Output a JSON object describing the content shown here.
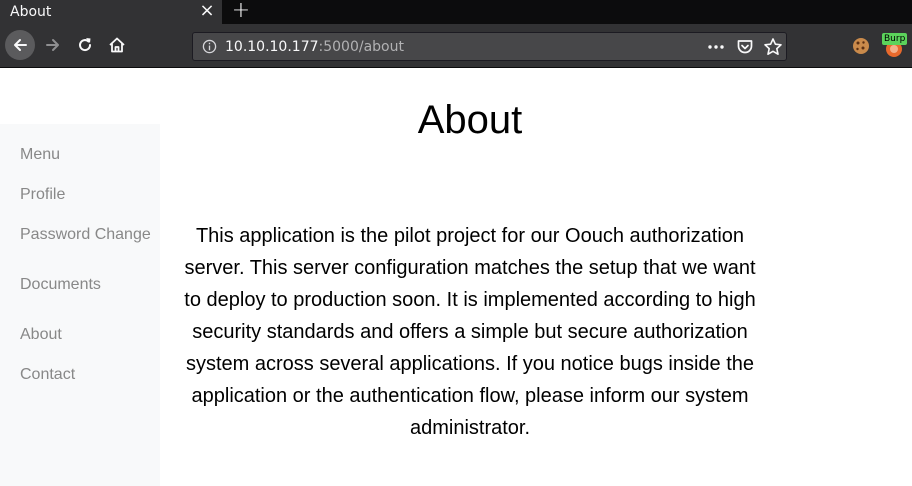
{
  "browser": {
    "tab_title": "About",
    "tab_close": "×",
    "new_tab": "+",
    "url_host": "10.10.10.177",
    "url_rest": ":5000/about",
    "burp_label": "Burp"
  },
  "page": {
    "title": "About",
    "sidebar": {
      "items": [
        {
          "label": "Menu"
        },
        {
          "label": "Profile"
        },
        {
          "label": "Password Change"
        },
        {
          "label": "Documents"
        },
        {
          "label": "About"
        },
        {
          "label": "Contact"
        }
      ]
    },
    "body_text": "This application is the pilot project for our Oouch authorization server. This server configuration matches the setup that we want to deploy to production soon. It is implemented according to high security standards and offers a simple but secure authorization system across several applications. If you notice bugs inside the application or the authentication flow, please inform our system administrator."
  },
  "colors": {
    "chrome_dark": "#0c0c0d",
    "chrome": "#323234",
    "urlbar": "#474749",
    "sidebar_bg": "#f8f9fa",
    "sidebar_link": "#888888",
    "burp_badge": "#5bd35b"
  },
  "icons": [
    "back-arrow-icon",
    "forward-arrow-icon",
    "reload-icon",
    "home-icon",
    "info-icon",
    "more-dots-icon",
    "pocket-icon",
    "star-icon",
    "cookie-extension-icon",
    "burp-extension-icon"
  ]
}
